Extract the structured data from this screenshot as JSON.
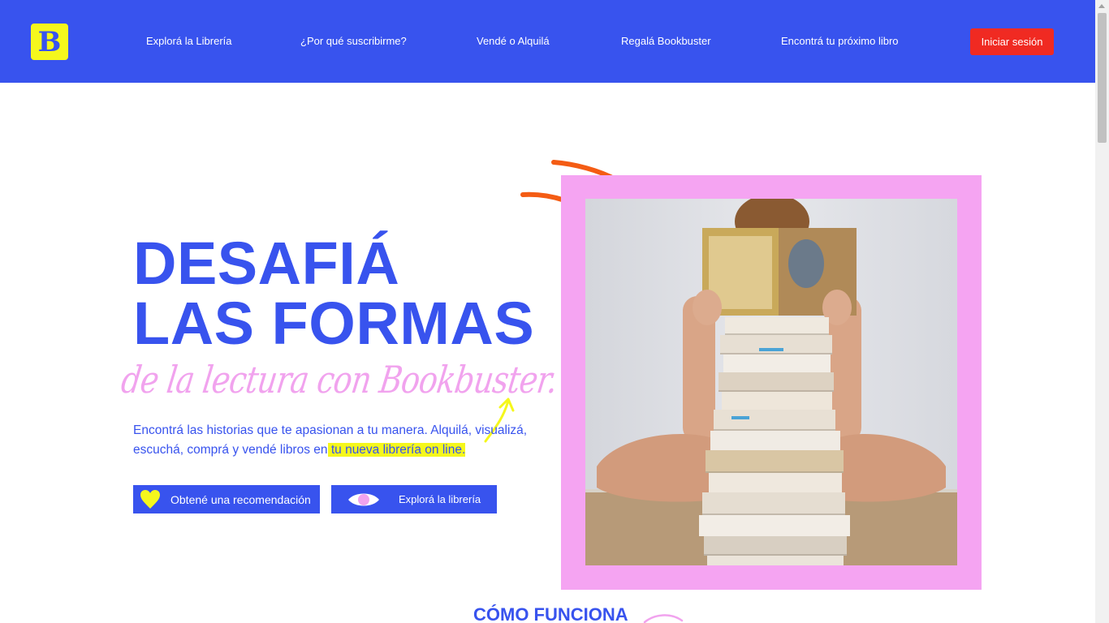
{
  "brand": {
    "logo_letter": "B",
    "accent": "#3853ee",
    "yellow": "#f5f71c",
    "pink": "#f5a4f2",
    "red": "#f02a22"
  },
  "nav": {
    "items": [
      {
        "label": "Explorá la Librería"
      },
      {
        "label": "¿Por qué suscribirme?"
      },
      {
        "label": "Vendé o Alquilá"
      },
      {
        "label": "Regalá Bookbuster"
      },
      {
        "label": "Encontrá tu próximo libro"
      }
    ],
    "login_label": "Iniciar sesión"
  },
  "hero": {
    "title_line1": "DESAFIÁ",
    "title_line2": "LAS FORMAS",
    "script": "de la lectura con Bookbuster.",
    "desc_part1": "Encontrá las historias que te apasionan a tu manera. Alquilá, visualizá, escuchá, comprá y vendé libros en",
    "desc_highlight": " tu nueva librería on line.",
    "btn_recommend": "Obtené una recomendación",
    "btn_explore": "Explorá la librería",
    "icons": {
      "recommend": "heart-icon",
      "explore": "eye-icon"
    }
  },
  "section": {
    "how_title": "CÓMO FUNCIONA"
  }
}
